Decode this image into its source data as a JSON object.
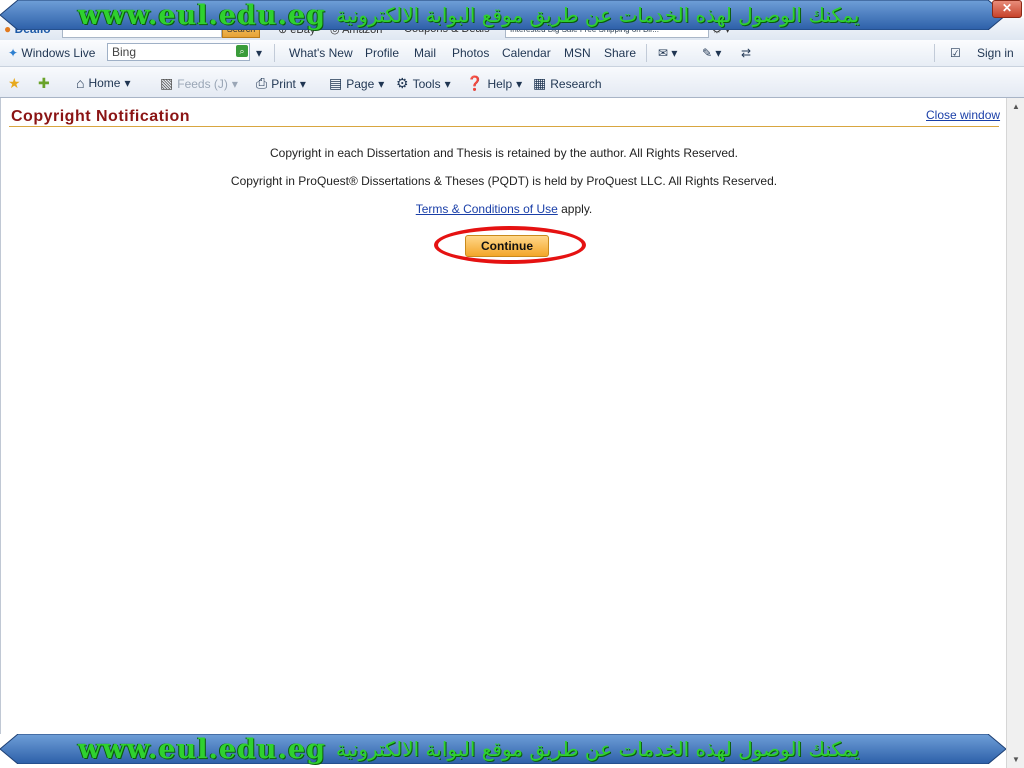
{
  "banner": {
    "url": "www.eul.edu.eg",
    "arabic": "يمكنك الوصول لهذه الخدمات عن طريق موقع البوابة الالكترونية"
  },
  "toolbar_dealio": {
    "brand": "Dealio",
    "search_label": "Search",
    "links": [
      "eBay",
      "Amazon",
      "Coupons & Deals"
    ],
    "promo_text": "Interested Big Sale Free Shipping on Bir..."
  },
  "toolbar_live": {
    "brand": "Windows Live",
    "search_value": "Bing",
    "links": [
      "What's New",
      "Profile",
      "Mail",
      "Photos",
      "Calendar",
      "MSN",
      "Share"
    ],
    "sign_in": "Sign in"
  },
  "command_bar": {
    "home": "Home",
    "feeds": "Feeds (J)",
    "print": "Print",
    "page": "Page",
    "tools": "Tools",
    "help": "Help",
    "research": "Research"
  },
  "notification": {
    "title": "Copyright Notification",
    "close_label": "Close window",
    "line1": "Copyright in each Dissertation and Thesis is retained by the author. All Rights Reserved.",
    "line2": "Copyright in ProQuest® Dissertations & Theses (PQDT) is held by ProQuest LLC. All Rights Reserved.",
    "terms_link": "Terms & Conditions of Use",
    "terms_suffix": " apply.",
    "continue_label": "Continue"
  },
  "colors": {
    "banner_text": "#2fd12f",
    "title": "#8b1414",
    "link": "#1a3fa8",
    "highlight": "#e51212",
    "button": "#f3a62a"
  }
}
